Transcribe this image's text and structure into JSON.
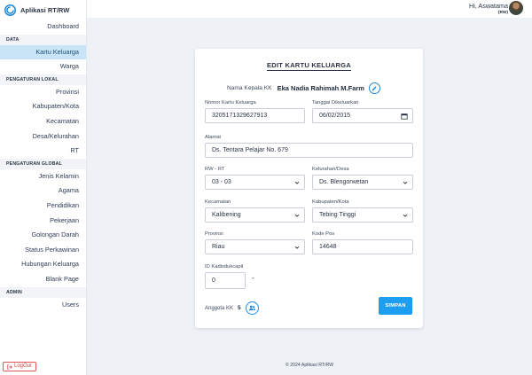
{
  "brand": {
    "title": "Aplikasi RT/RW"
  },
  "sidebar": {
    "dashboard": "Dashboard",
    "sections": [
      {
        "title": "DATA",
        "items": [
          "Kartu Keluarga",
          "Warga"
        ]
      },
      {
        "title": "PENGATURAN LOKAL",
        "items": [
          "Provinsi",
          "Kabupaten/Kota",
          "Kecamatan",
          "Desa/Kelurahan",
          "RT"
        ]
      },
      {
        "title": "PENGATURAN GLOBAL",
        "items": [
          "Jenis Kelamin",
          "Agama",
          "Pendidikan",
          "Pekerjaan",
          "Golongan Darah",
          "Status Perkawinan",
          "Hubungan Keluarga",
          "Blank Page"
        ]
      },
      {
        "title": "ADMIN",
        "items": [
          "Users"
        ]
      }
    ],
    "active_item": "Kartu Keluarga",
    "logout": "LogOut"
  },
  "topbar": {
    "user_name": "Hi, Aswatama",
    "user_role": "(RW)"
  },
  "form": {
    "title": "EDIT KARTU KELUARGA",
    "head_label": "Nama Kepala KK",
    "head_value": "Eka Nadia Rahimah M.Farm",
    "nomor_kk": {
      "label": "Nomor Kartu Keluarga",
      "value": "3205171329627913"
    },
    "tanggal": {
      "label": "Tanggal Dikeluarkan",
      "value": "06/02/2015"
    },
    "alamat": {
      "label": "Alamat",
      "value": "Ds. Tentara Pelajar No. 679"
    },
    "rw_rt": {
      "label": "RW - RT",
      "value": "03 - 03"
    },
    "kelurahan": {
      "label": "Kelurahan/Desa",
      "value": "Ds. Blengorwetan"
    },
    "kecamatan": {
      "label": "Kecamatan",
      "value": "Kalibening"
    },
    "kabupaten": {
      "label": "Kabupaten/Kota",
      "value": "Tebing Tinggi"
    },
    "provinsi": {
      "label": "Provinsi",
      "value": "Riau"
    },
    "kode_pos": {
      "label": "Kode Pos",
      "value": "14648"
    },
    "id_kadisdukcapil": {
      "label": "ID Kadisdukcapil",
      "value": "0",
      "suffix": "-"
    },
    "anggota_label": "Anggota KK",
    "anggota_count": "5",
    "submit_label": "SIMPAN"
  },
  "footer": {
    "text": "© 2024 Aplikasi RT/RW"
  },
  "colors": {
    "accent": "#1d9ef0",
    "active_bg": "#c9e4f6",
    "logout": "#d84242"
  }
}
